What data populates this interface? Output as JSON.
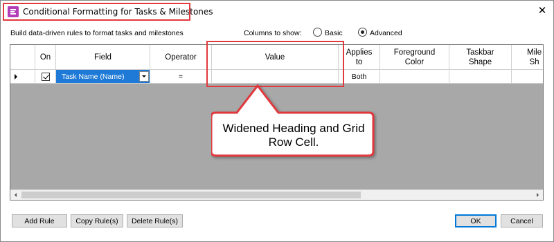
{
  "window": {
    "title": "Conditional Formatting for Tasks & Milestones",
    "close_glyph": "✕"
  },
  "description": "Build data-driven rules to format tasks and milestones",
  "columns_to_show": {
    "label": "Columns to show:",
    "options": [
      "Basic",
      "Advanced"
    ],
    "selected": "Advanced"
  },
  "grid": {
    "headers": [
      "On",
      "Field",
      "Operator",
      "Value",
      "Applies\nto",
      "Foreground\nColor",
      "Taskbar\nShape",
      "Mile\nSh"
    ],
    "rows": [
      {
        "on": true,
        "field": "Task Name (Name)",
        "operator": "=",
        "value": "",
        "applies_to": "Both",
        "foreground_color": "",
        "taskbar_shape": "",
        "milestone_shape": ""
      }
    ]
  },
  "annotation": {
    "text": "Widened Heading and Grid Row Cell.",
    "color": "#e0393e"
  },
  "buttons": {
    "add_rule": "Add Rule",
    "copy_rules": "Copy Rule(s)",
    "delete_rules": "Delete Rule(s)",
    "ok": "OK",
    "cancel": "Cancel"
  },
  "colors": {
    "selection": "#1e7ad6",
    "grid_background": "#a8a8a8",
    "app_icon": "#b33fb8"
  }
}
